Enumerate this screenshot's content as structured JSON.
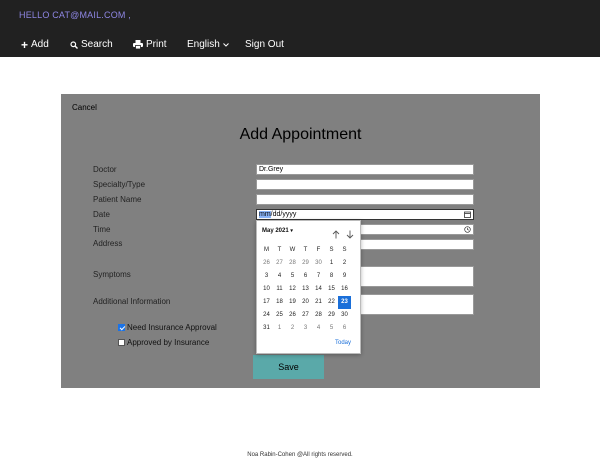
{
  "header": {
    "greeting": "HELLO CAT@MAIL.COM ,",
    "nav": {
      "add": "Add",
      "search": "Search",
      "print": "Print",
      "language": "English",
      "signout": "Sign Out"
    }
  },
  "form": {
    "cancel": "Cancel",
    "title": "Add Appointment",
    "labels": {
      "doctor": "Doctor",
      "specialty": "Specialty/Type",
      "patient": "Patient Name",
      "date": "Date",
      "time": "Time",
      "address": "Address",
      "symptoms": "Symptoms",
      "info": "Additional Information"
    },
    "values": {
      "doctor": "Dr.Grey",
      "date_mm": "mm",
      "date_rest": "/dd/yyyy"
    },
    "checkboxes": {
      "insurance_approval": {
        "label": "Need Insurance Approval",
        "checked": true
      },
      "approved": {
        "label": "Approved by Insurance",
        "checked": false
      }
    },
    "save": "Save"
  },
  "datepicker": {
    "month": "May 2021",
    "weekdays": [
      "M",
      "T",
      "W",
      "T",
      "F",
      "S",
      "S"
    ],
    "weeks": [
      [
        "26",
        "27",
        "28",
        "29",
        "30",
        "1",
        "2"
      ],
      [
        "3",
        "4",
        "5",
        "6",
        "7",
        "8",
        "9"
      ],
      [
        "10",
        "11",
        "12",
        "13",
        "14",
        "15",
        "16"
      ],
      [
        "17",
        "18",
        "19",
        "20",
        "21",
        "22",
        "23"
      ],
      [
        "24",
        "25",
        "26",
        "27",
        "28",
        "29",
        "30"
      ],
      [
        "31",
        "1",
        "2",
        "3",
        "4",
        "5",
        "6"
      ]
    ],
    "selected": "23",
    "today": "Today"
  },
  "footer": "Noa Rabin-Cohen @All rights reserved.",
  "colors": {
    "topbar": "#212121",
    "greeting": "#8e86e3",
    "panel": "#808080",
    "save": "#5aa9a9",
    "accent": "#1a6fd9"
  }
}
